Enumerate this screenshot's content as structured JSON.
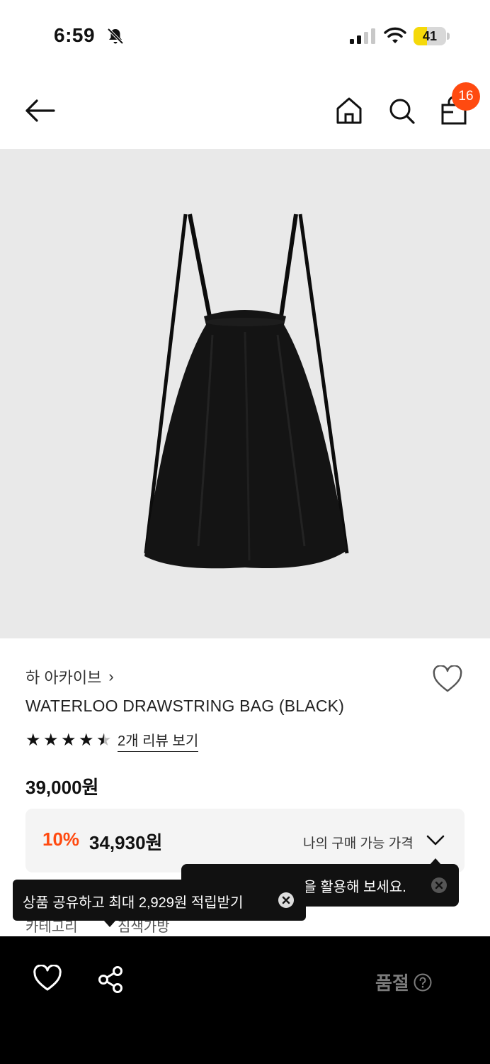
{
  "status_bar": {
    "time": "6:59",
    "battery": "41",
    "battery_level": 0.41,
    "icons": [
      "bell-slash-icon",
      "cellular-signal-icon",
      "wifi-icon",
      "battery-icon"
    ]
  },
  "header": {
    "icons": [
      "back-arrow-icon",
      "home-icon",
      "search-icon",
      "shopping-bag-icon"
    ],
    "cart_count": "16"
  },
  "product": {
    "brand": "하 아카이브",
    "brand_chevron": "›",
    "title": "WATERLOO DRAWSTRING BAG (BLACK)",
    "rating": 4.5,
    "review_link": "2개 리뷰 보기",
    "price": "39,000원",
    "discount_percent": "10%",
    "discount_price": "34,930원",
    "my_price_label": "나의 구매 가능 가격"
  },
  "info_row": {
    "label": "카테고리",
    "value": "짐색가방"
  },
  "tooltips": {
    "filter_tip": "필터로 상황의 기능을 활용해 보세요.",
    "share_tip": "상품 공유하고 최대 2,929원 적립받기"
  },
  "bottom_bar": {
    "soldout_label": "품절"
  },
  "colors": {
    "accent": "#ff4a10",
    "image_bg": "#e9e9e9",
    "bottom_bar": "#000000",
    "soldout_text": "#7b7b7b"
  }
}
